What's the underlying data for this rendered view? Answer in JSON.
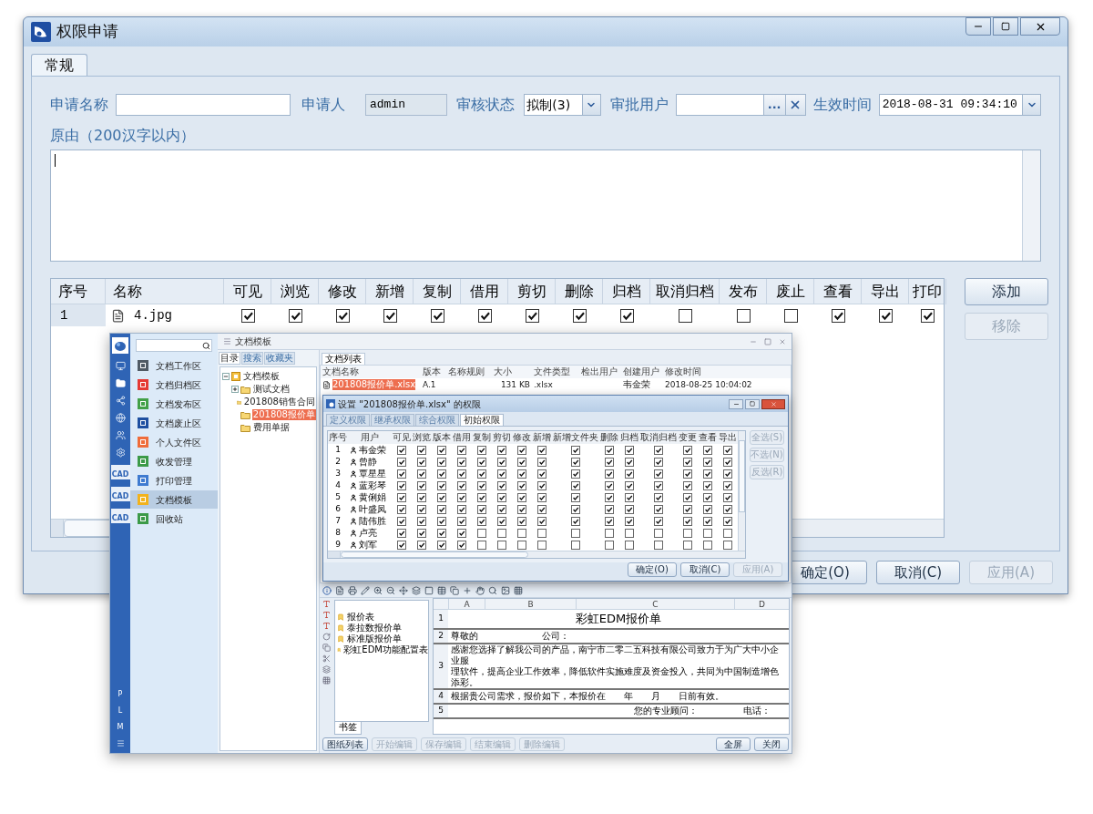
{
  "window": {
    "title": "权限申请"
  },
  "tabs": [
    {
      "label": "常规",
      "selected": true
    }
  ],
  "form": {
    "name_label": "申请名称",
    "applicant_label": "申请人",
    "applicant": "admin",
    "status_label": "审核状态",
    "status": "拟制(3)",
    "approver_label": "审批用户",
    "approver_browse": "...",
    "effective_label": "生效时间",
    "effective": "2018-08-31 09:34:10",
    "reason_label": "原由（200汉字以内）"
  },
  "table": {
    "columns": [
      "序号",
      "名称",
      "可见",
      "浏览",
      "修改",
      "新增",
      "复制",
      "借用",
      "剪切",
      "删除",
      "归档",
      "取消归档",
      "发布",
      "废止",
      "查看",
      "导出",
      "打印"
    ],
    "rows": [
      {
        "index": "1",
        "name": "4.jpg",
        "checks": [
          true,
          true,
          true,
          true,
          true,
          true,
          true,
          true,
          true,
          false,
          false,
          false,
          true,
          true,
          true
        ]
      }
    ]
  },
  "side_buttons": [
    {
      "label": "添加",
      "disabled": false
    },
    {
      "label": "移除",
      "disabled": true
    }
  ],
  "footer_buttons": [
    {
      "label": "确定(O)",
      "disabled": false
    },
    {
      "label": "取消(C)",
      "disabled": false
    },
    {
      "label": "应用(A)",
      "disabled": true
    }
  ],
  "inset": {
    "rail_tiles": [
      "CAD",
      "CAD",
      "CAD"
    ],
    "rail_letters": [
      "P",
      "L",
      "M"
    ],
    "nav_items": [
      {
        "label": "文档工作区",
        "color": "#505a64",
        "selected": false
      },
      {
        "label": "文档归档区",
        "color": "#e53935",
        "selected": false
      },
      {
        "label": "文档发布区",
        "color": "#43a047",
        "selected": false
      },
      {
        "label": "文档废止区",
        "color": "#1e4fa0",
        "selected": false
      },
      {
        "label": "个人文件区",
        "color": "#ef6c3a",
        "selected": false
      },
      {
        "label": "收发管理",
        "color": "#3c9a48",
        "selected": false
      },
      {
        "label": "打印管理",
        "color": "#3f7bd0",
        "selected": false
      },
      {
        "label": "文档模板",
        "color": "#f2b21c",
        "selected": true
      },
      {
        "label": "回收站",
        "color": "#3c9a48",
        "selected": false
      }
    ],
    "title": "文档模板",
    "tree_tabs": [
      {
        "label": "目录",
        "selected": true
      },
      {
        "label": "搜索",
        "selected": false
      },
      {
        "label": "收藏夹",
        "selected": false
      }
    ],
    "tree": [
      {
        "label": "文档模板",
        "kind": "root",
        "expanded": true,
        "selected": false,
        "children": [
          {
            "label": "测试文档",
            "kind": "folder",
            "expanded": false,
            "selected": false
          },
          {
            "label": "201808销售合同",
            "kind": "folder",
            "selected": false
          },
          {
            "label": "201808报价单",
            "kind": "folder",
            "selected": true
          },
          {
            "label": "费用单据",
            "kind": "folder",
            "selected": false
          }
        ]
      }
    ],
    "list_tab": "文档列表",
    "file_columns": [
      "文档名称",
      "版本",
      "名称规则",
      "大小",
      "文件类型",
      "检出用户",
      "创建用户",
      "修改时间"
    ],
    "files": [
      {
        "name": "201808报价单.xlsx",
        "version": "A.1",
        "size": "131 KB",
        "type": ".xlsx",
        "creator": "韦金荣",
        "modified": "2018-08-25 10:04:02",
        "selected": true
      }
    ],
    "permission_dialog": {
      "title": "设置 \"201808报价单.xlsx\" 的权限",
      "tabs": [
        {
          "label": "定义权限",
          "selected": false
        },
        {
          "label": "继承权限",
          "selected": false
        },
        {
          "label": "综合权限",
          "selected": false
        },
        {
          "label": "初始权限",
          "selected": true
        }
      ],
      "columns": [
        "序号",
        "用户",
        "可见",
        "浏览",
        "版本",
        "借用",
        "复制",
        "剪切",
        "修改",
        "新增",
        "新增文件夹",
        "删除",
        "归档",
        "取消归档",
        "变更",
        "查看",
        "导出"
      ],
      "rows": [
        {
          "index": "1",
          "user": "韦金荣",
          "checks": [
            true,
            true,
            true,
            true,
            true,
            true,
            true,
            true,
            true,
            true,
            true,
            true,
            true,
            true,
            true
          ]
        },
        {
          "index": "2",
          "user": "曾静",
          "checks": [
            true,
            true,
            true,
            true,
            true,
            true,
            true,
            true,
            true,
            true,
            true,
            true,
            true,
            true,
            true
          ]
        },
        {
          "index": "3",
          "user": "覃星星",
          "checks": [
            true,
            true,
            true,
            true,
            true,
            true,
            true,
            true,
            true,
            true,
            true,
            true,
            true,
            true,
            true
          ]
        },
        {
          "index": "4",
          "user": "蓝彩琴",
          "checks": [
            true,
            true,
            true,
            true,
            true,
            true,
            true,
            true,
            true,
            true,
            true,
            true,
            true,
            true,
            true
          ]
        },
        {
          "index": "5",
          "user": "黄俐娟",
          "checks": [
            true,
            true,
            true,
            true,
            true,
            true,
            true,
            true,
            true,
            true,
            true,
            true,
            true,
            true,
            true
          ]
        },
        {
          "index": "6",
          "user": "叶盛凤",
          "checks": [
            true,
            true,
            true,
            true,
            true,
            true,
            true,
            true,
            true,
            true,
            true,
            true,
            true,
            true,
            true
          ]
        },
        {
          "index": "7",
          "user": "陆伟胜",
          "checks": [
            true,
            true,
            true,
            true,
            true,
            true,
            true,
            true,
            true,
            true,
            true,
            true,
            true,
            true,
            true
          ]
        },
        {
          "index": "8",
          "user": "卢亮",
          "checks": [
            true,
            true,
            true,
            true,
            false,
            false,
            false,
            false,
            false,
            false,
            false,
            false,
            false,
            false,
            false
          ]
        },
        {
          "index": "9",
          "user": "刘军",
          "checks": [
            true,
            true,
            true,
            true,
            false,
            false,
            false,
            false,
            false,
            false,
            false,
            false,
            false,
            false,
            false
          ]
        }
      ],
      "side_buttons": [
        {
          "label": "全选(S)",
          "disabled": true
        },
        {
          "label": "不选(N)",
          "disabled": true
        },
        {
          "label": "反选(R)",
          "disabled": true
        }
      ],
      "buttons": [
        {
          "label": "确定(O)",
          "disabled": false
        },
        {
          "label": "取消(C)",
          "disabled": false
        },
        {
          "label": "应用(A)",
          "disabled": true
        }
      ]
    },
    "viewer": {
      "bookmarks": [
        "报价表",
        "泰拉数报价单",
        "标准版报价单",
        "彩虹EDM功能配置表"
      ],
      "bookmark_tab": "书签",
      "columns": [
        "A",
        "B",
        "C",
        "D"
      ],
      "rows": [
        {
          "number": "1",
          "kind": "title",
          "cells": [
            "彩虹EDM报价单"
          ]
        },
        {
          "number": "2",
          "kind": "fields",
          "cells": [
            "尊敬的",
            "公司："
          ]
        },
        {
          "number": "3",
          "kind": "paragraph",
          "cells": [
            "感谢您选择了解我公司的产品，南宁市二零二五科技有限公司致力于为广大中小企业服",
            "理软件，提高企业工作效率，降低软件实施难度及资金投入，共同为中国制造增色添彩。"
          ]
        },
        {
          "number": "4",
          "kind": "fields",
          "cells": [
            "根据贵公司需求，报价如下，本报价在　　年　　月　　日前有效。"
          ]
        },
        {
          "number": "5",
          "kind": "signature",
          "cells": [
            "您的专业顾问：",
            "电话："
          ]
        }
      ],
      "buttons": [
        {
          "label": "图纸列表",
          "disabled": false
        },
        {
          "label": "开始编辑",
          "disabled": true
        },
        {
          "label": "保存编辑",
          "disabled": true
        },
        {
          "label": "结束编辑",
          "disabled": true
        },
        {
          "label": "删除编辑",
          "disabled": true
        }
      ],
      "right_buttons": [
        {
          "label": "全屏",
          "disabled": false
        },
        {
          "label": "关闭",
          "disabled": false
        }
      ]
    }
  }
}
